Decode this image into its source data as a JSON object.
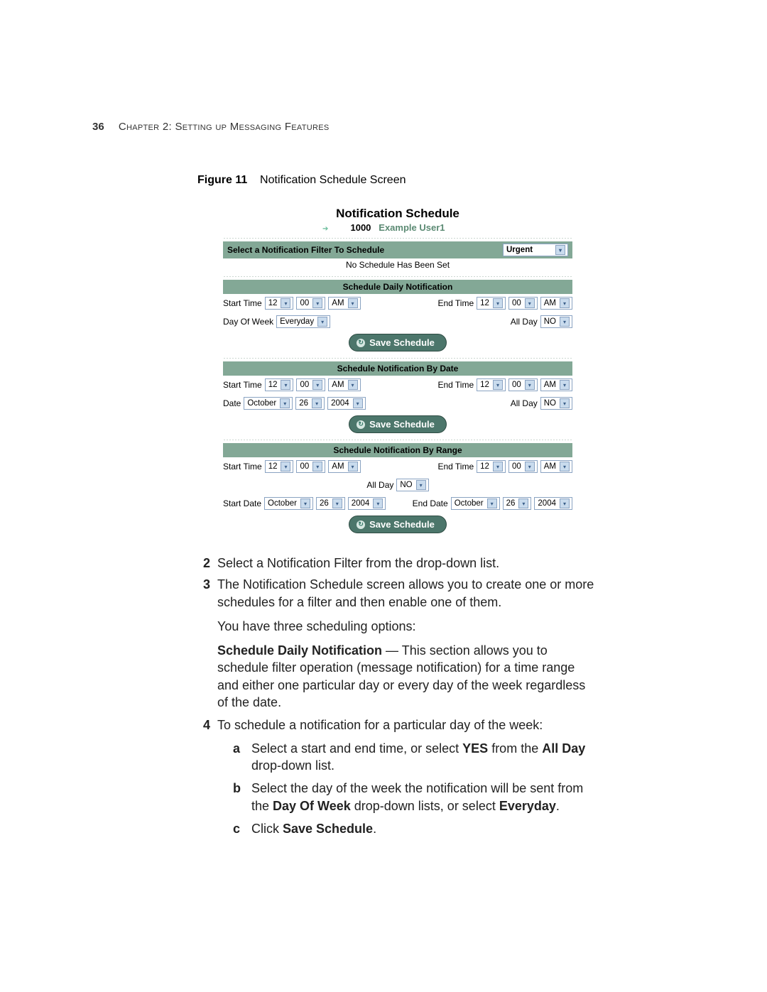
{
  "header": {
    "page_number": "36",
    "chapter_line": "Chapter 2: Setting up Messaging Features"
  },
  "figure": {
    "label": "Figure 11",
    "caption": "Notification Schedule Screen"
  },
  "screenshot": {
    "title": "Notification Schedule",
    "user_id": "1000",
    "user_name": "Example User1",
    "filter_section": {
      "label": "Select a Notification Filter To Schedule",
      "selected": "Urgent",
      "status_note": "No Schedule Has Been Set"
    },
    "daily": {
      "header": "Schedule Daily Notification",
      "start_label": "Start Time",
      "start_hr": "12",
      "start_min": "00",
      "start_ampm": "AM",
      "end_label": "End Time",
      "end_hr": "12",
      "end_min": "00",
      "end_ampm": "AM",
      "dow_label": "Day Of Week",
      "dow_value": "Everyday",
      "allday_label": "All Day",
      "allday_value": "NO",
      "save_label": "Save Schedule"
    },
    "bydate": {
      "header": "Schedule Notification By Date",
      "start_label": "Start Time",
      "start_hr": "12",
      "start_min": "00",
      "start_ampm": "AM",
      "end_label": "End Time",
      "end_hr": "12",
      "end_min": "00",
      "end_ampm": "AM",
      "date_label": "Date",
      "date_month": "October",
      "date_day": "26",
      "date_year": "2004",
      "allday_label": "All Day",
      "allday_value": "NO",
      "save_label": "Save Schedule"
    },
    "byrange": {
      "header": "Schedule Notification By Range",
      "start_label": "Start Time",
      "start_hr": "12",
      "start_min": "00",
      "start_ampm": "AM",
      "end_label": "End Time",
      "end_hr": "12",
      "end_min": "00",
      "end_ampm": "AM",
      "allday_label": "All Day",
      "allday_value": "NO",
      "startdate_label": "Start Date",
      "sd_month": "October",
      "sd_day": "26",
      "sd_year": "2004",
      "enddate_label": "End Date",
      "ed_month": "October",
      "ed_day": "26",
      "ed_year": "2004",
      "save_label": "Save Schedule"
    }
  },
  "body": {
    "item2": {
      "n": "2",
      "text": "Select a Notification Filter from the drop-down list."
    },
    "item3": {
      "n": "3",
      "line1": "The Notification Schedule screen allows you to create one or more schedules for a filter and then enable one of them.",
      "line2": "You have three scheduling options:",
      "line3_bold": "Schedule Daily Notification",
      "line3_rest": " — This section allows you to schedule filter operation (message notification) for a time range and either one particular day or every day of the week regardless of the date."
    },
    "item4": {
      "n": "4",
      "text": "To schedule a notification for a particular day of the week:",
      "a": {
        "l": "a",
        "pre": "Select a start and end time, or select ",
        "b1": "YES",
        "mid": " from the ",
        "b2": "All Day",
        "post": " drop-down list."
      },
      "b": {
        "l": "b",
        "pre": "Select the day of the week the notification will be sent from the ",
        "b1": "Day Of Week",
        "mid": " drop-down lists, or select ",
        "b2": "Everyday",
        "post": "."
      },
      "c": {
        "l": "c",
        "pre": "Click ",
        "b1": "Save Schedule",
        "post": "."
      }
    }
  }
}
